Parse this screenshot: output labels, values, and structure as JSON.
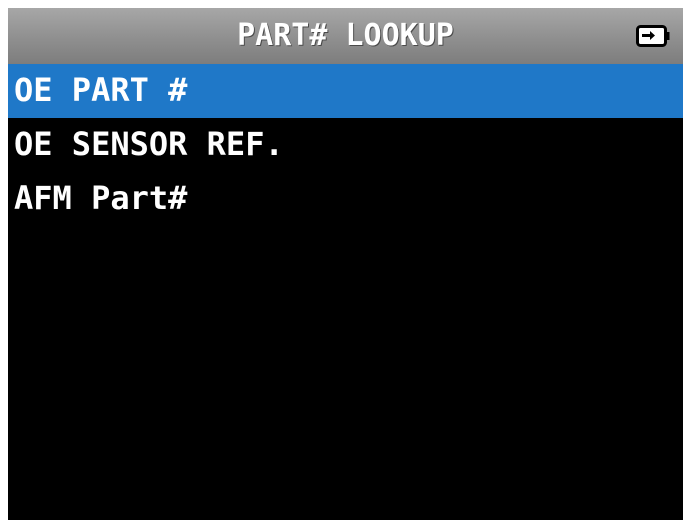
{
  "header": {
    "title": "PART# LOOKUP",
    "battery_icon": "battery-charging-icon"
  },
  "menu": {
    "selected_index": 0,
    "items": [
      {
        "label": "OE PART #"
      },
      {
        "label": "OE SENSOR REF."
      },
      {
        "label": "AFM Part#"
      }
    ]
  },
  "colors": {
    "screen_background": "#000000",
    "title_bar": "#969696",
    "selection_highlight": "#1f78c8",
    "text": "#ffffff"
  }
}
